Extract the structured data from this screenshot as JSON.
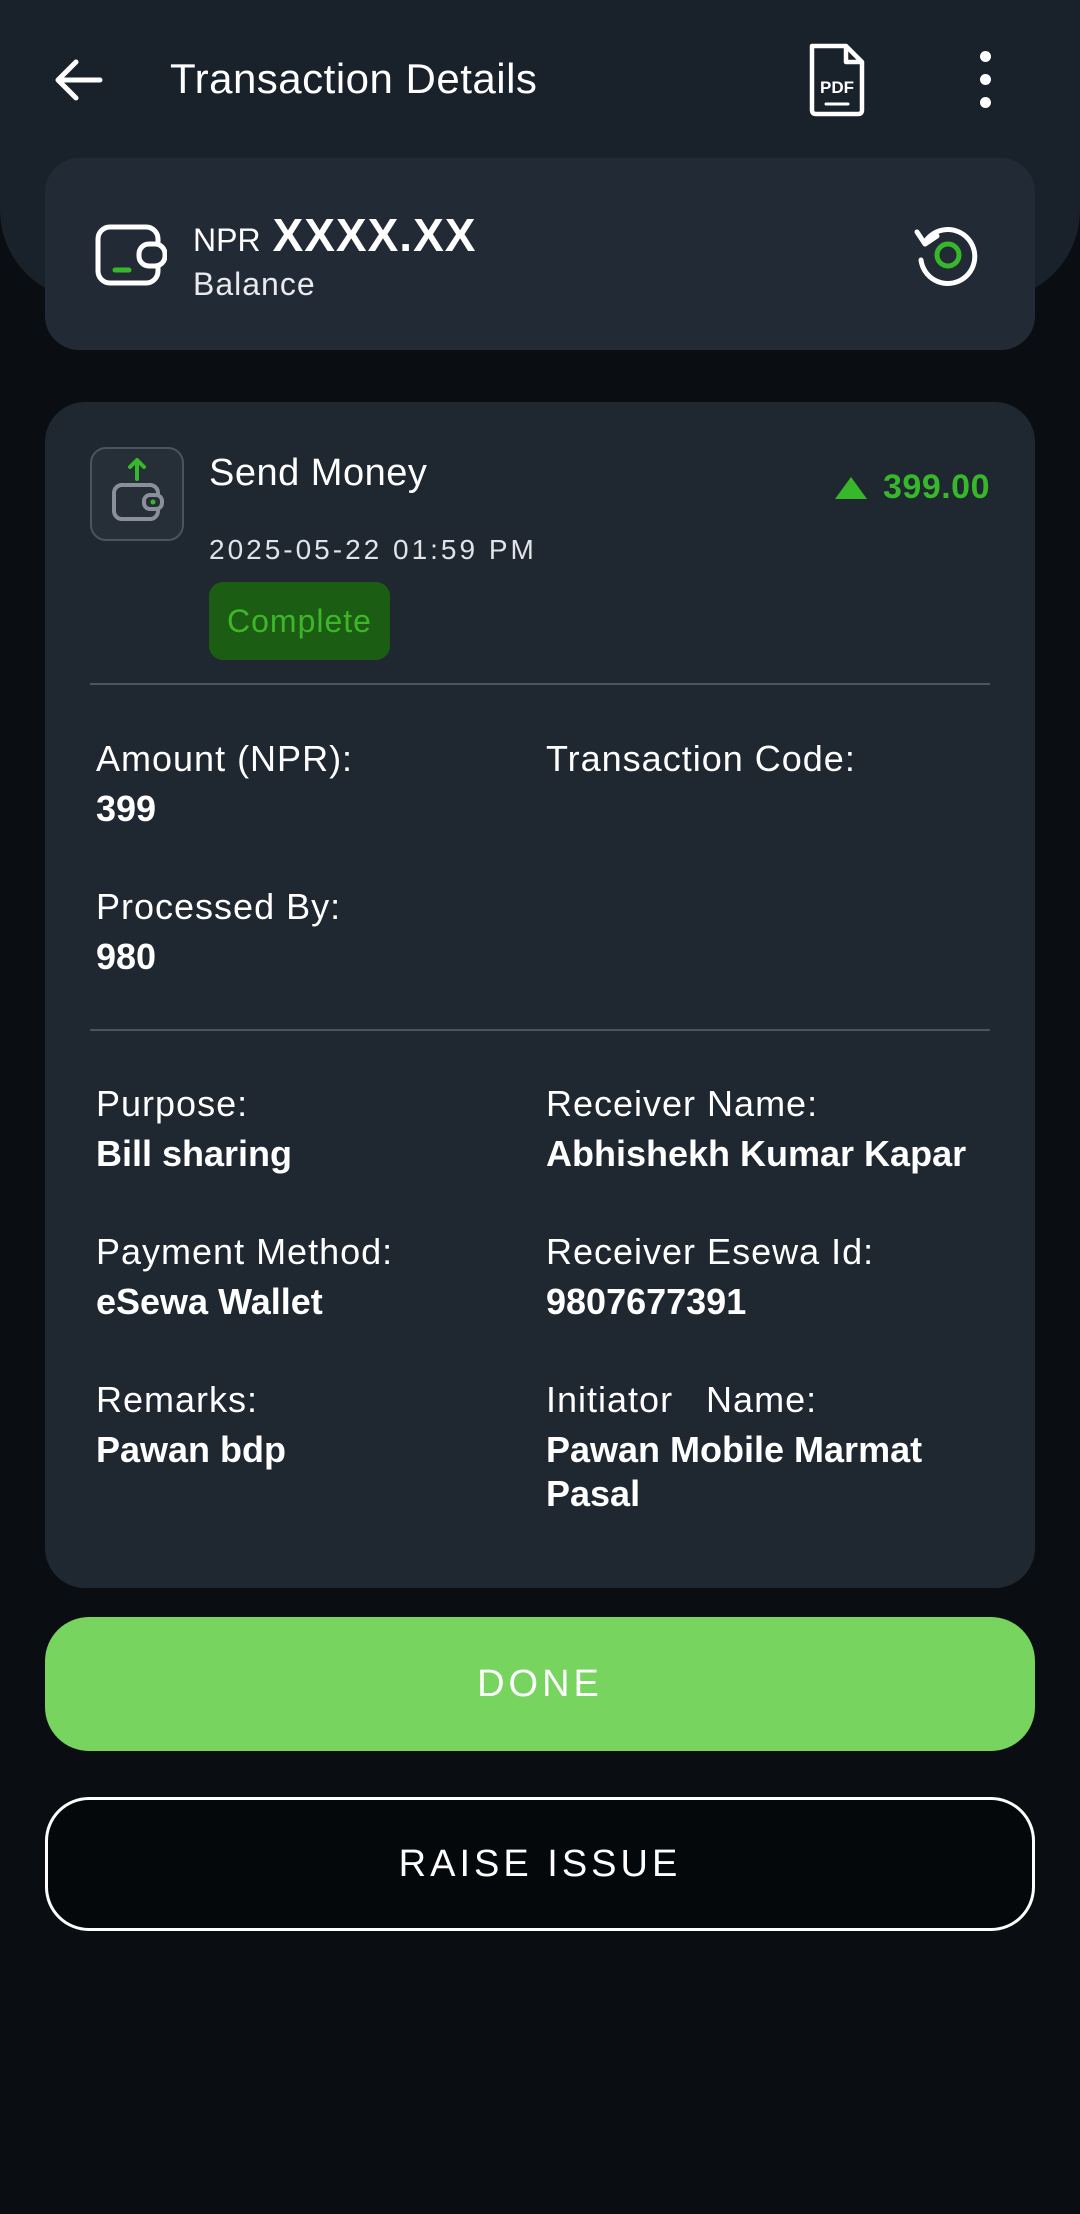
{
  "header": {
    "title": "Transaction Details"
  },
  "balance": {
    "currency": "NPR",
    "amount": "XXXX.XX",
    "label": "Balance"
  },
  "transaction": {
    "type": "Send Money",
    "datetime": "2025-05-22 01:59 PM",
    "status": "Complete",
    "amount": "399.00",
    "direction_icon": "triangle-up-icon"
  },
  "fields": {
    "amount_label": "Amount (NPR):",
    "amount_value": "399",
    "txn_code_label": "Transaction Code:",
    "txn_code_value": "",
    "processed_label": "Processed By:",
    "processed_value": "980",
    "purpose_label": "Purpose:",
    "purpose_value": "Bill sharing",
    "receiver_name_label": "Receiver Name:",
    "receiver_name_value": "Abhishekh Kumar Kapar",
    "payment_method_label": "Payment Method:",
    "payment_method_value": "eSewa Wallet",
    "receiver_id_label": "Receiver Esewa Id:",
    "receiver_id_value": "9807677391",
    "remarks_label": "Remarks:",
    "remarks_value": "Pawan bdp",
    "initiator_label": "Initiator   Name:",
    "initiator_value": "Pawan Mobile Marmat Pasal"
  },
  "actions": {
    "done_label": "DONE",
    "raise_issue_label": "RAISE ISSUE"
  },
  "colors": {
    "accent_green": "#76d45f",
    "amount_green": "#36b82a",
    "card_bg": "#1f2731"
  }
}
